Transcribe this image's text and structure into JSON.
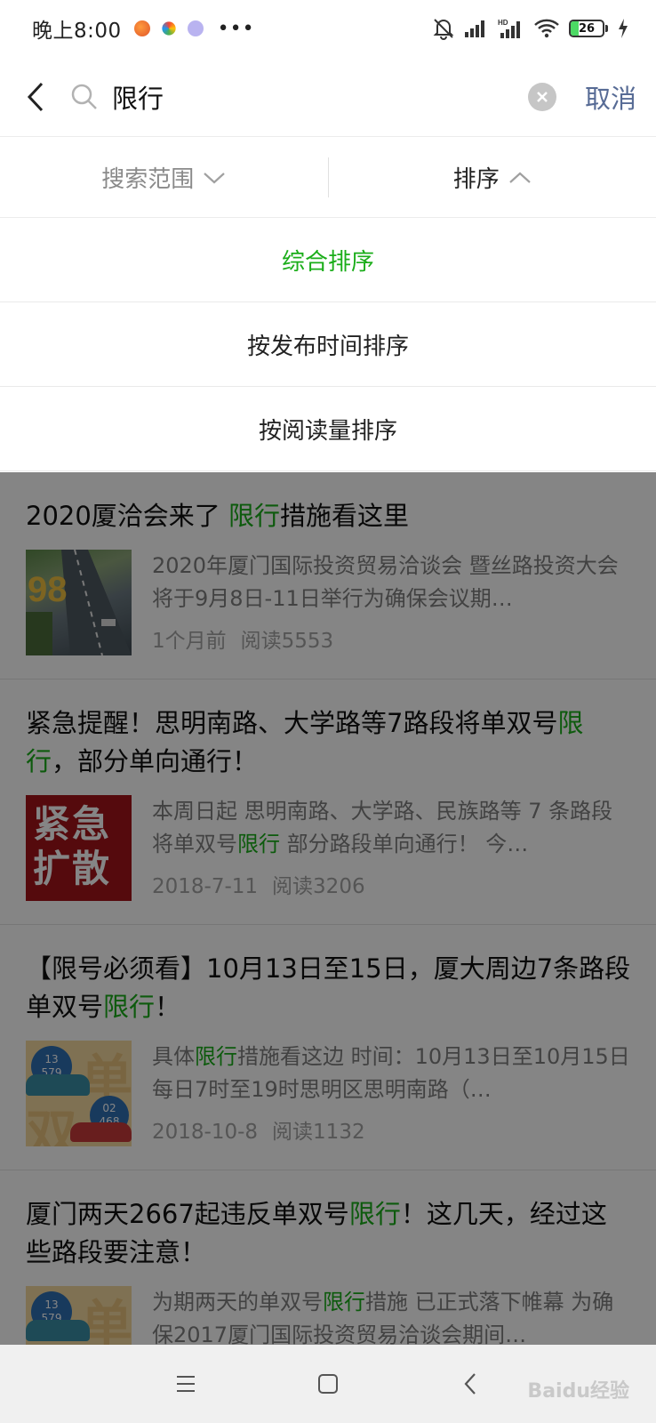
{
  "status_bar": {
    "time": "晚上8:00",
    "more": "•••",
    "battery_level": "26",
    "battery_fraction": 0.26,
    "icons": [
      "app-orange-icon",
      "app-colorful-icon",
      "app-purple-icon",
      "mute-bell-icon",
      "signal-icon",
      "hd-signal-icon",
      "wifi-icon",
      "battery-icon",
      "charging-icon"
    ]
  },
  "search": {
    "query": "限行",
    "cancel_label": "取消"
  },
  "filters": {
    "scope_label": "搜索范围",
    "sort_label": "排序"
  },
  "sort_options": [
    {
      "label": "综合排序",
      "active": true
    },
    {
      "label": "按发布时间排序",
      "active": false
    },
    {
      "label": "按阅读量排序",
      "active": false
    }
  ],
  "results": [
    {
      "title_parts": [
        "2020厦洽会来了 ",
        "限行",
        "措施看这里"
      ],
      "snippet_parts": [
        "2020年厦门国际投资贸易洽谈会 暨丝路投资大会将于9月8日-11日举行为确保会议期…"
      ],
      "time": "1个月前",
      "reads": "阅读5553"
    },
    {
      "title_parts": [
        "紧急提醒！思明南路、大学路等7路段将单双号",
        "限行",
        "，部分单向通行！"
      ],
      "snippet_parts": [
        "本周日起 思明南路、大学路、民族路等 7 条路段 将单双号",
        "限行",
        " 部分路段单向通行！ 今…"
      ],
      "thumb_text": "紧急扩散",
      "time": "2018-7-11",
      "reads": "阅读3206"
    },
    {
      "title_parts": [
        "【限号必须看】10月13日至15日，厦大周边7条路段单双号",
        "限行",
        "！"
      ],
      "snippet_parts": [
        "具体",
        "限行",
        "措施看这边 时间：10月13日至10月15日 每日7时至19时思明区思明南路（…"
      ],
      "time": "2018-10-8",
      "reads": "阅读1132"
    },
    {
      "title_parts": [
        "厦门两天2667起违反单双号",
        "限行",
        "！这几天，经过这些路段要注意！"
      ],
      "snippet_parts": [
        "为期两天的单双号",
        "限行",
        "措施 已正式落下帷幕 为确保2017厦门国际投资贸易洽谈会期间…"
      ]
    }
  ],
  "thumb_labels": {
    "odd": "13\n579",
    "even": "02\n468",
    "char_dan": "单",
    "char_shuang": "双"
  },
  "watermark": "Baidu经验",
  "colors": {
    "accent_green": "#1aad19",
    "link_blue": "#576b95",
    "overlay": "rgba(0,0,0,0.48)"
  }
}
